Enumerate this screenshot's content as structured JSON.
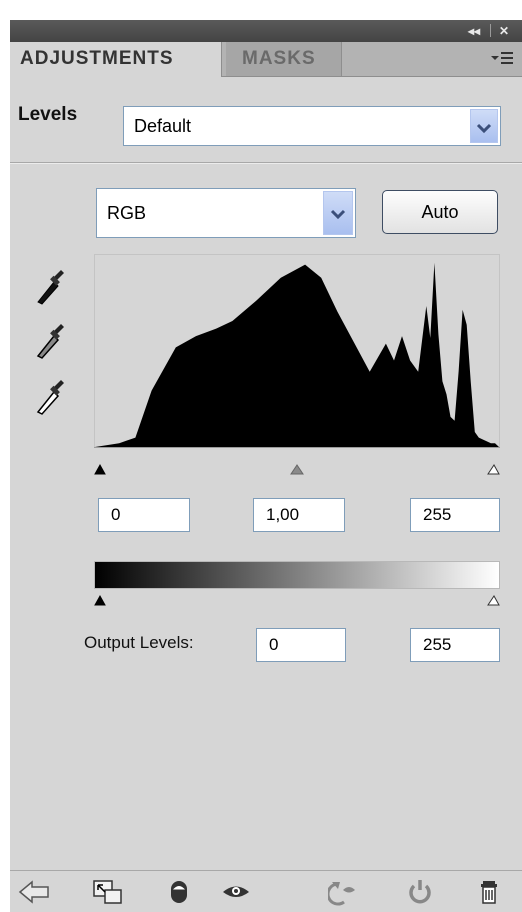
{
  "window_controls": {
    "collapse": "◂◂",
    "close": "✕"
  },
  "tabs": [
    {
      "label": "ADJUSTMENTS",
      "active": true
    },
    {
      "label": "MASKS",
      "active": false
    }
  ],
  "panel_menu_icon": "panel-menu-icon",
  "preset": {
    "label": "Levels",
    "value": "Default"
  },
  "channel": {
    "value": "RGB"
  },
  "auto_button": {
    "label": "Auto"
  },
  "eyedroppers": [
    {
      "name": "black-point-eyedropper-icon",
      "color": "#000000"
    },
    {
      "name": "gray-point-eyedropper-icon",
      "color": "#808080"
    },
    {
      "name": "white-point-eyedropper-icon",
      "color": "#ffffff"
    }
  ],
  "histogram": {
    "x": [
      0,
      6,
      10,
      14,
      20,
      25,
      30,
      34,
      40,
      46,
      52,
      56,
      60,
      64,
      68,
      72,
      74,
      76,
      78,
      80,
      82,
      83,
      84,
      85,
      86,
      87,
      88,
      89,
      90,
      91,
      92,
      93,
      94,
      95,
      96,
      97,
      98,
      99,
      100
    ],
    "counts": [
      0,
      2,
      5,
      30,
      53,
      59,
      63,
      67,
      78,
      90,
      97,
      90,
      72,
      56,
      40,
      55,
      46,
      59,
      46,
      40,
      75,
      58,
      98,
      60,
      35,
      28,
      16,
      14,
      40,
      73,
      65,
      35,
      8,
      5,
      4,
      3,
      2,
      2,
      0
    ]
  },
  "input_levels": {
    "black": "0",
    "gamma": "1,00",
    "white": "255"
  },
  "output_levels": {
    "label": "Output Levels:",
    "black": "0",
    "white": "255"
  },
  "bottom_toolbar": [
    "return-arrow-icon",
    "clip-to-layer-icon",
    "layer-visibility-state-icon",
    "view-previous-state-icon",
    "reset-icon",
    "delete-icon"
  ]
}
